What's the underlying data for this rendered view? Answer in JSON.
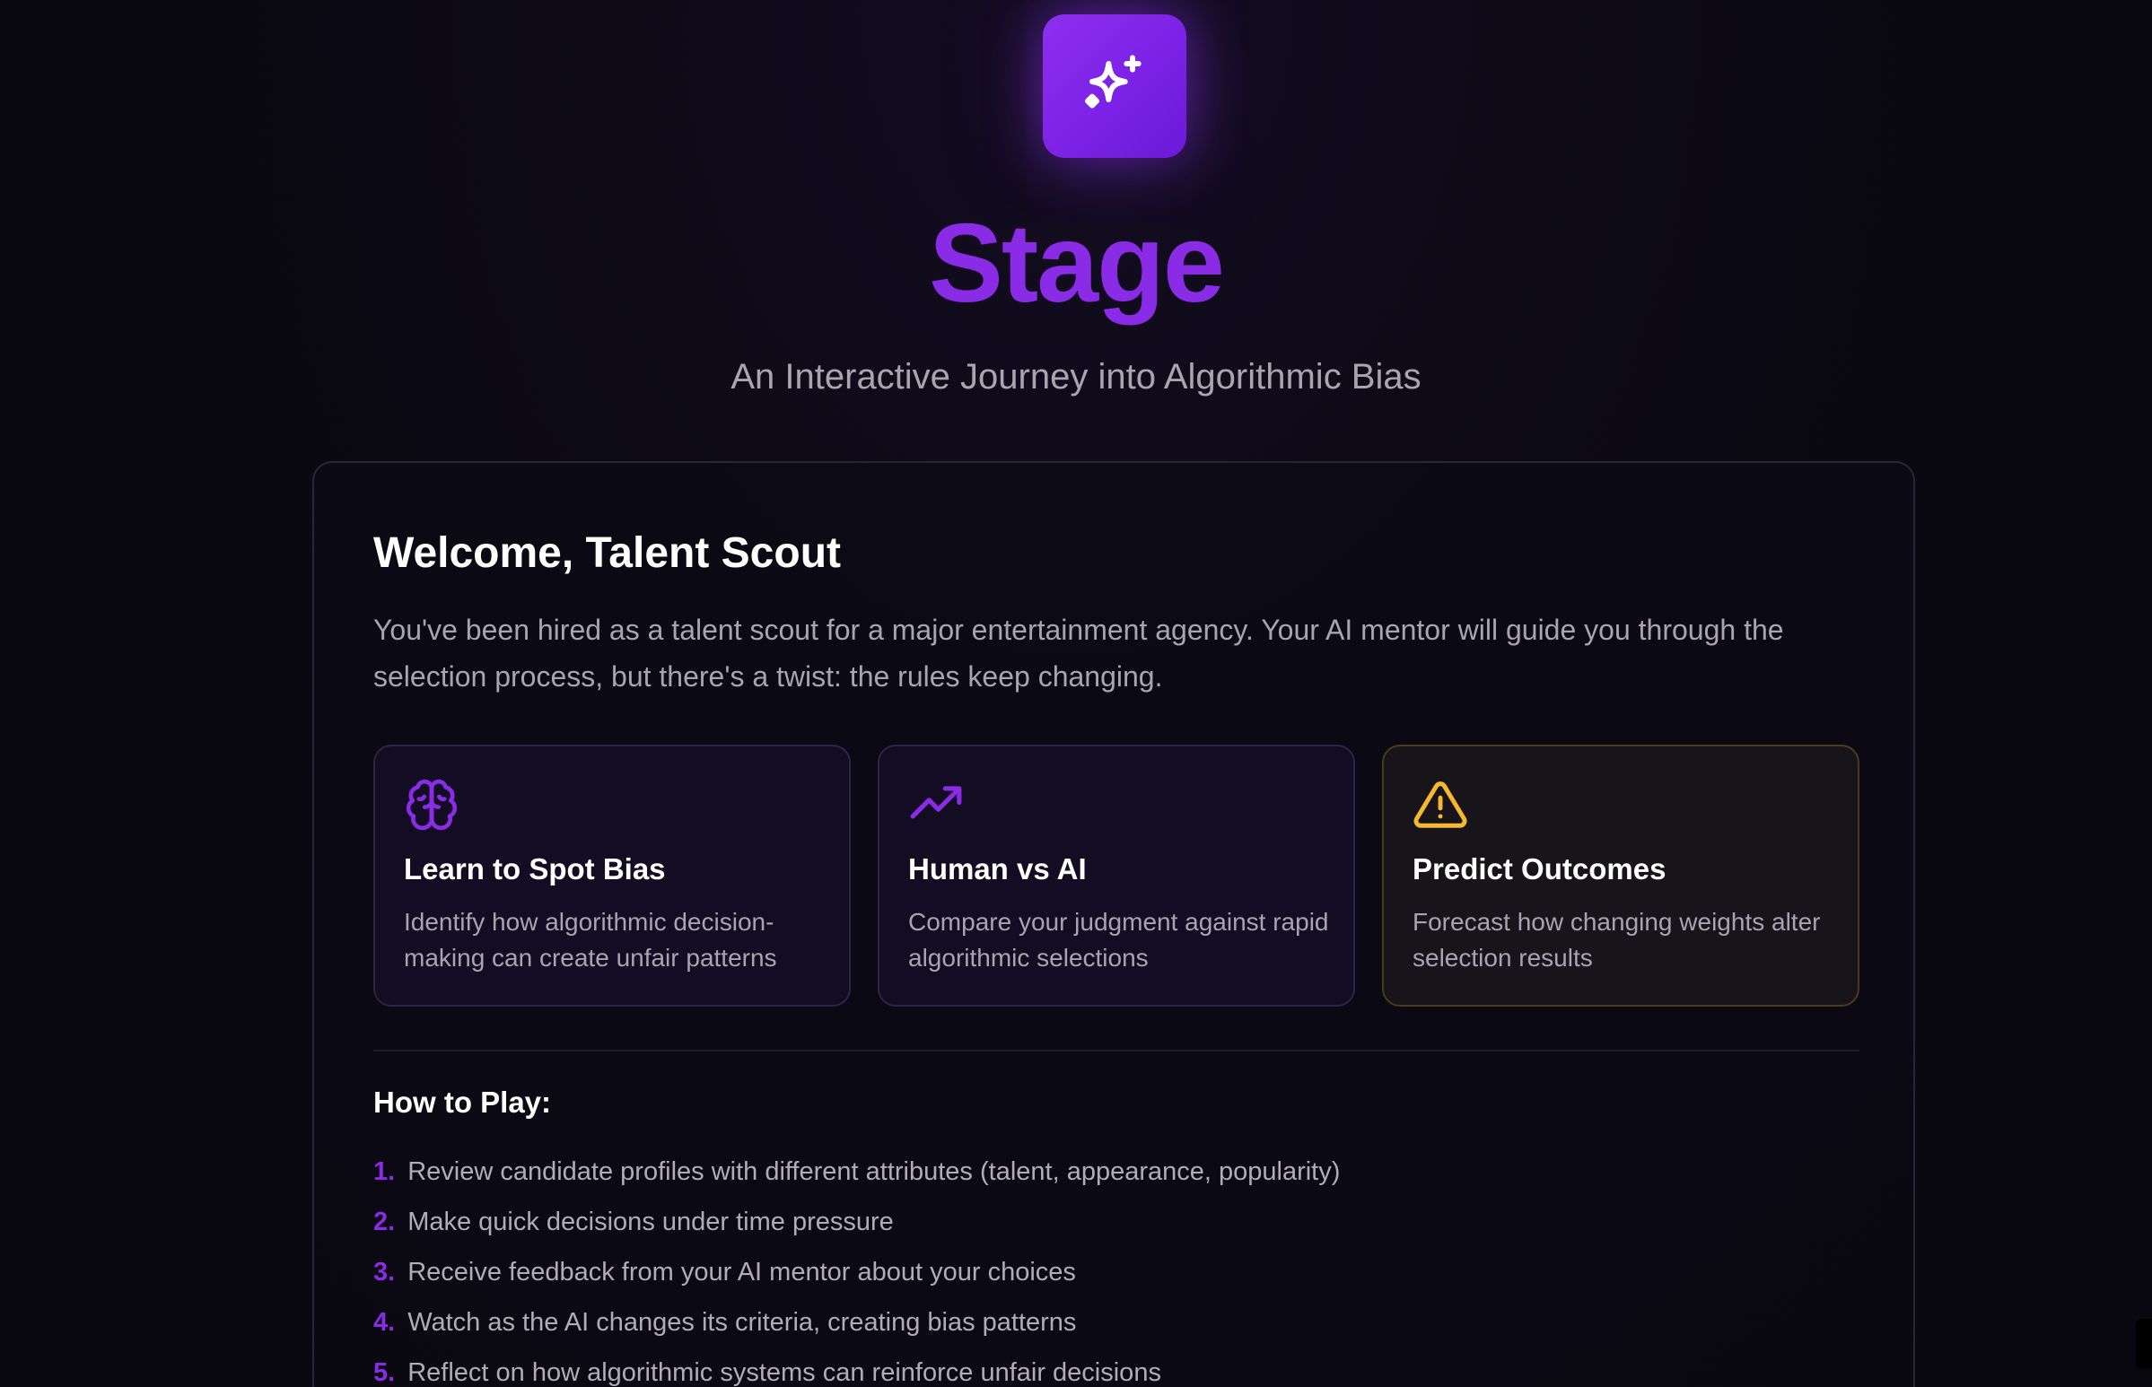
{
  "app": {
    "logo_icon": "sparkles-icon",
    "title": "Stage",
    "subtitle": "An Interactive Journey into Algorithmic Bias"
  },
  "colors": {
    "accent": "#8a2be6",
    "background": "#0b0913",
    "warning": "#f5b82e"
  },
  "welcome": {
    "heading": "Welcome, Talent Scout",
    "intro": "You've been hired as a talent scout for a major entertainment agency. Your AI mentor will guide you through the selection process, but there's a twist: the rules keep changing."
  },
  "features": [
    {
      "icon": "brain-icon",
      "title": "Learn to Spot Bias",
      "description": "Identify how algorithmic decision-making can create unfair patterns"
    },
    {
      "icon": "trending-up-icon",
      "title": "Human vs AI",
      "description": "Compare your judgment against rapid algorithmic selections"
    },
    {
      "icon": "warning-triangle-icon",
      "title": "Predict Outcomes",
      "description": "Forecast how changing weights alter selection results"
    }
  ],
  "how_to_play": {
    "heading": "How to Play:",
    "steps": [
      {
        "num": "1.",
        "text": "Review candidate profiles with different attributes (talent, appearance, popularity)"
      },
      {
        "num": "2.",
        "text": "Make quick decisions under time pressure"
      },
      {
        "num": "3.",
        "text": "Receive feedback from your AI mentor about your choices"
      },
      {
        "num": "4.",
        "text": "Watch as the AI changes its criteria, creating bias patterns"
      },
      {
        "num": "5.",
        "text": "Reflect on how algorithmic systems can reinforce unfair decisions"
      }
    ]
  }
}
